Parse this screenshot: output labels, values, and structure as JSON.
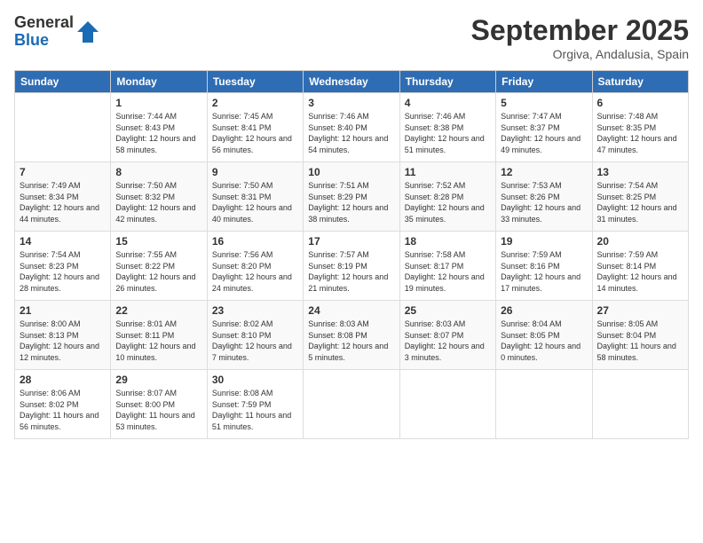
{
  "logo": {
    "general": "General",
    "blue": "Blue"
  },
  "title": "September 2025",
  "subtitle": "Orgiva, Andalusia, Spain",
  "headers": [
    "Sunday",
    "Monday",
    "Tuesday",
    "Wednesday",
    "Thursday",
    "Friday",
    "Saturday"
  ],
  "weeks": [
    [
      {
        "day": "",
        "sunrise": "",
        "sunset": "",
        "daylight": ""
      },
      {
        "day": "1",
        "sunrise": "Sunrise: 7:44 AM",
        "sunset": "Sunset: 8:43 PM",
        "daylight": "Daylight: 12 hours and 58 minutes."
      },
      {
        "day": "2",
        "sunrise": "Sunrise: 7:45 AM",
        "sunset": "Sunset: 8:41 PM",
        "daylight": "Daylight: 12 hours and 56 minutes."
      },
      {
        "day": "3",
        "sunrise": "Sunrise: 7:46 AM",
        "sunset": "Sunset: 8:40 PM",
        "daylight": "Daylight: 12 hours and 54 minutes."
      },
      {
        "day": "4",
        "sunrise": "Sunrise: 7:46 AM",
        "sunset": "Sunset: 8:38 PM",
        "daylight": "Daylight: 12 hours and 51 minutes."
      },
      {
        "day": "5",
        "sunrise": "Sunrise: 7:47 AM",
        "sunset": "Sunset: 8:37 PM",
        "daylight": "Daylight: 12 hours and 49 minutes."
      },
      {
        "day": "6",
        "sunrise": "Sunrise: 7:48 AM",
        "sunset": "Sunset: 8:35 PM",
        "daylight": "Daylight: 12 hours and 47 minutes."
      }
    ],
    [
      {
        "day": "7",
        "sunrise": "Sunrise: 7:49 AM",
        "sunset": "Sunset: 8:34 PM",
        "daylight": "Daylight: 12 hours and 44 minutes."
      },
      {
        "day": "8",
        "sunrise": "Sunrise: 7:50 AM",
        "sunset": "Sunset: 8:32 PM",
        "daylight": "Daylight: 12 hours and 42 minutes."
      },
      {
        "day": "9",
        "sunrise": "Sunrise: 7:50 AM",
        "sunset": "Sunset: 8:31 PM",
        "daylight": "Daylight: 12 hours and 40 minutes."
      },
      {
        "day": "10",
        "sunrise": "Sunrise: 7:51 AM",
        "sunset": "Sunset: 8:29 PM",
        "daylight": "Daylight: 12 hours and 38 minutes."
      },
      {
        "day": "11",
        "sunrise": "Sunrise: 7:52 AM",
        "sunset": "Sunset: 8:28 PM",
        "daylight": "Daylight: 12 hours and 35 minutes."
      },
      {
        "day": "12",
        "sunrise": "Sunrise: 7:53 AM",
        "sunset": "Sunset: 8:26 PM",
        "daylight": "Daylight: 12 hours and 33 minutes."
      },
      {
        "day": "13",
        "sunrise": "Sunrise: 7:54 AM",
        "sunset": "Sunset: 8:25 PM",
        "daylight": "Daylight: 12 hours and 31 minutes."
      }
    ],
    [
      {
        "day": "14",
        "sunrise": "Sunrise: 7:54 AM",
        "sunset": "Sunset: 8:23 PM",
        "daylight": "Daylight: 12 hours and 28 minutes."
      },
      {
        "day": "15",
        "sunrise": "Sunrise: 7:55 AM",
        "sunset": "Sunset: 8:22 PM",
        "daylight": "Daylight: 12 hours and 26 minutes."
      },
      {
        "day": "16",
        "sunrise": "Sunrise: 7:56 AM",
        "sunset": "Sunset: 8:20 PM",
        "daylight": "Daylight: 12 hours and 24 minutes."
      },
      {
        "day": "17",
        "sunrise": "Sunrise: 7:57 AM",
        "sunset": "Sunset: 8:19 PM",
        "daylight": "Daylight: 12 hours and 21 minutes."
      },
      {
        "day": "18",
        "sunrise": "Sunrise: 7:58 AM",
        "sunset": "Sunset: 8:17 PM",
        "daylight": "Daylight: 12 hours and 19 minutes."
      },
      {
        "day": "19",
        "sunrise": "Sunrise: 7:59 AM",
        "sunset": "Sunset: 8:16 PM",
        "daylight": "Daylight: 12 hours and 17 minutes."
      },
      {
        "day": "20",
        "sunrise": "Sunrise: 7:59 AM",
        "sunset": "Sunset: 8:14 PM",
        "daylight": "Daylight: 12 hours and 14 minutes."
      }
    ],
    [
      {
        "day": "21",
        "sunrise": "Sunrise: 8:00 AM",
        "sunset": "Sunset: 8:13 PM",
        "daylight": "Daylight: 12 hours and 12 minutes."
      },
      {
        "day": "22",
        "sunrise": "Sunrise: 8:01 AM",
        "sunset": "Sunset: 8:11 PM",
        "daylight": "Daylight: 12 hours and 10 minutes."
      },
      {
        "day": "23",
        "sunrise": "Sunrise: 8:02 AM",
        "sunset": "Sunset: 8:10 PM",
        "daylight": "Daylight: 12 hours and 7 minutes."
      },
      {
        "day": "24",
        "sunrise": "Sunrise: 8:03 AM",
        "sunset": "Sunset: 8:08 PM",
        "daylight": "Daylight: 12 hours and 5 minutes."
      },
      {
        "day": "25",
        "sunrise": "Sunrise: 8:03 AM",
        "sunset": "Sunset: 8:07 PM",
        "daylight": "Daylight: 12 hours and 3 minutes."
      },
      {
        "day": "26",
        "sunrise": "Sunrise: 8:04 AM",
        "sunset": "Sunset: 8:05 PM",
        "daylight": "Daylight: 12 hours and 0 minutes."
      },
      {
        "day": "27",
        "sunrise": "Sunrise: 8:05 AM",
        "sunset": "Sunset: 8:04 PM",
        "daylight": "Daylight: 11 hours and 58 minutes."
      }
    ],
    [
      {
        "day": "28",
        "sunrise": "Sunrise: 8:06 AM",
        "sunset": "Sunset: 8:02 PM",
        "daylight": "Daylight: 11 hours and 56 minutes."
      },
      {
        "day": "29",
        "sunrise": "Sunrise: 8:07 AM",
        "sunset": "Sunset: 8:00 PM",
        "daylight": "Daylight: 11 hours and 53 minutes."
      },
      {
        "day": "30",
        "sunrise": "Sunrise: 8:08 AM",
        "sunset": "Sunset: 7:59 PM",
        "daylight": "Daylight: 11 hours and 51 minutes."
      },
      {
        "day": "",
        "sunrise": "",
        "sunset": "",
        "daylight": ""
      },
      {
        "day": "",
        "sunrise": "",
        "sunset": "",
        "daylight": ""
      },
      {
        "day": "",
        "sunrise": "",
        "sunset": "",
        "daylight": ""
      },
      {
        "day": "",
        "sunrise": "",
        "sunset": "",
        "daylight": ""
      }
    ]
  ]
}
